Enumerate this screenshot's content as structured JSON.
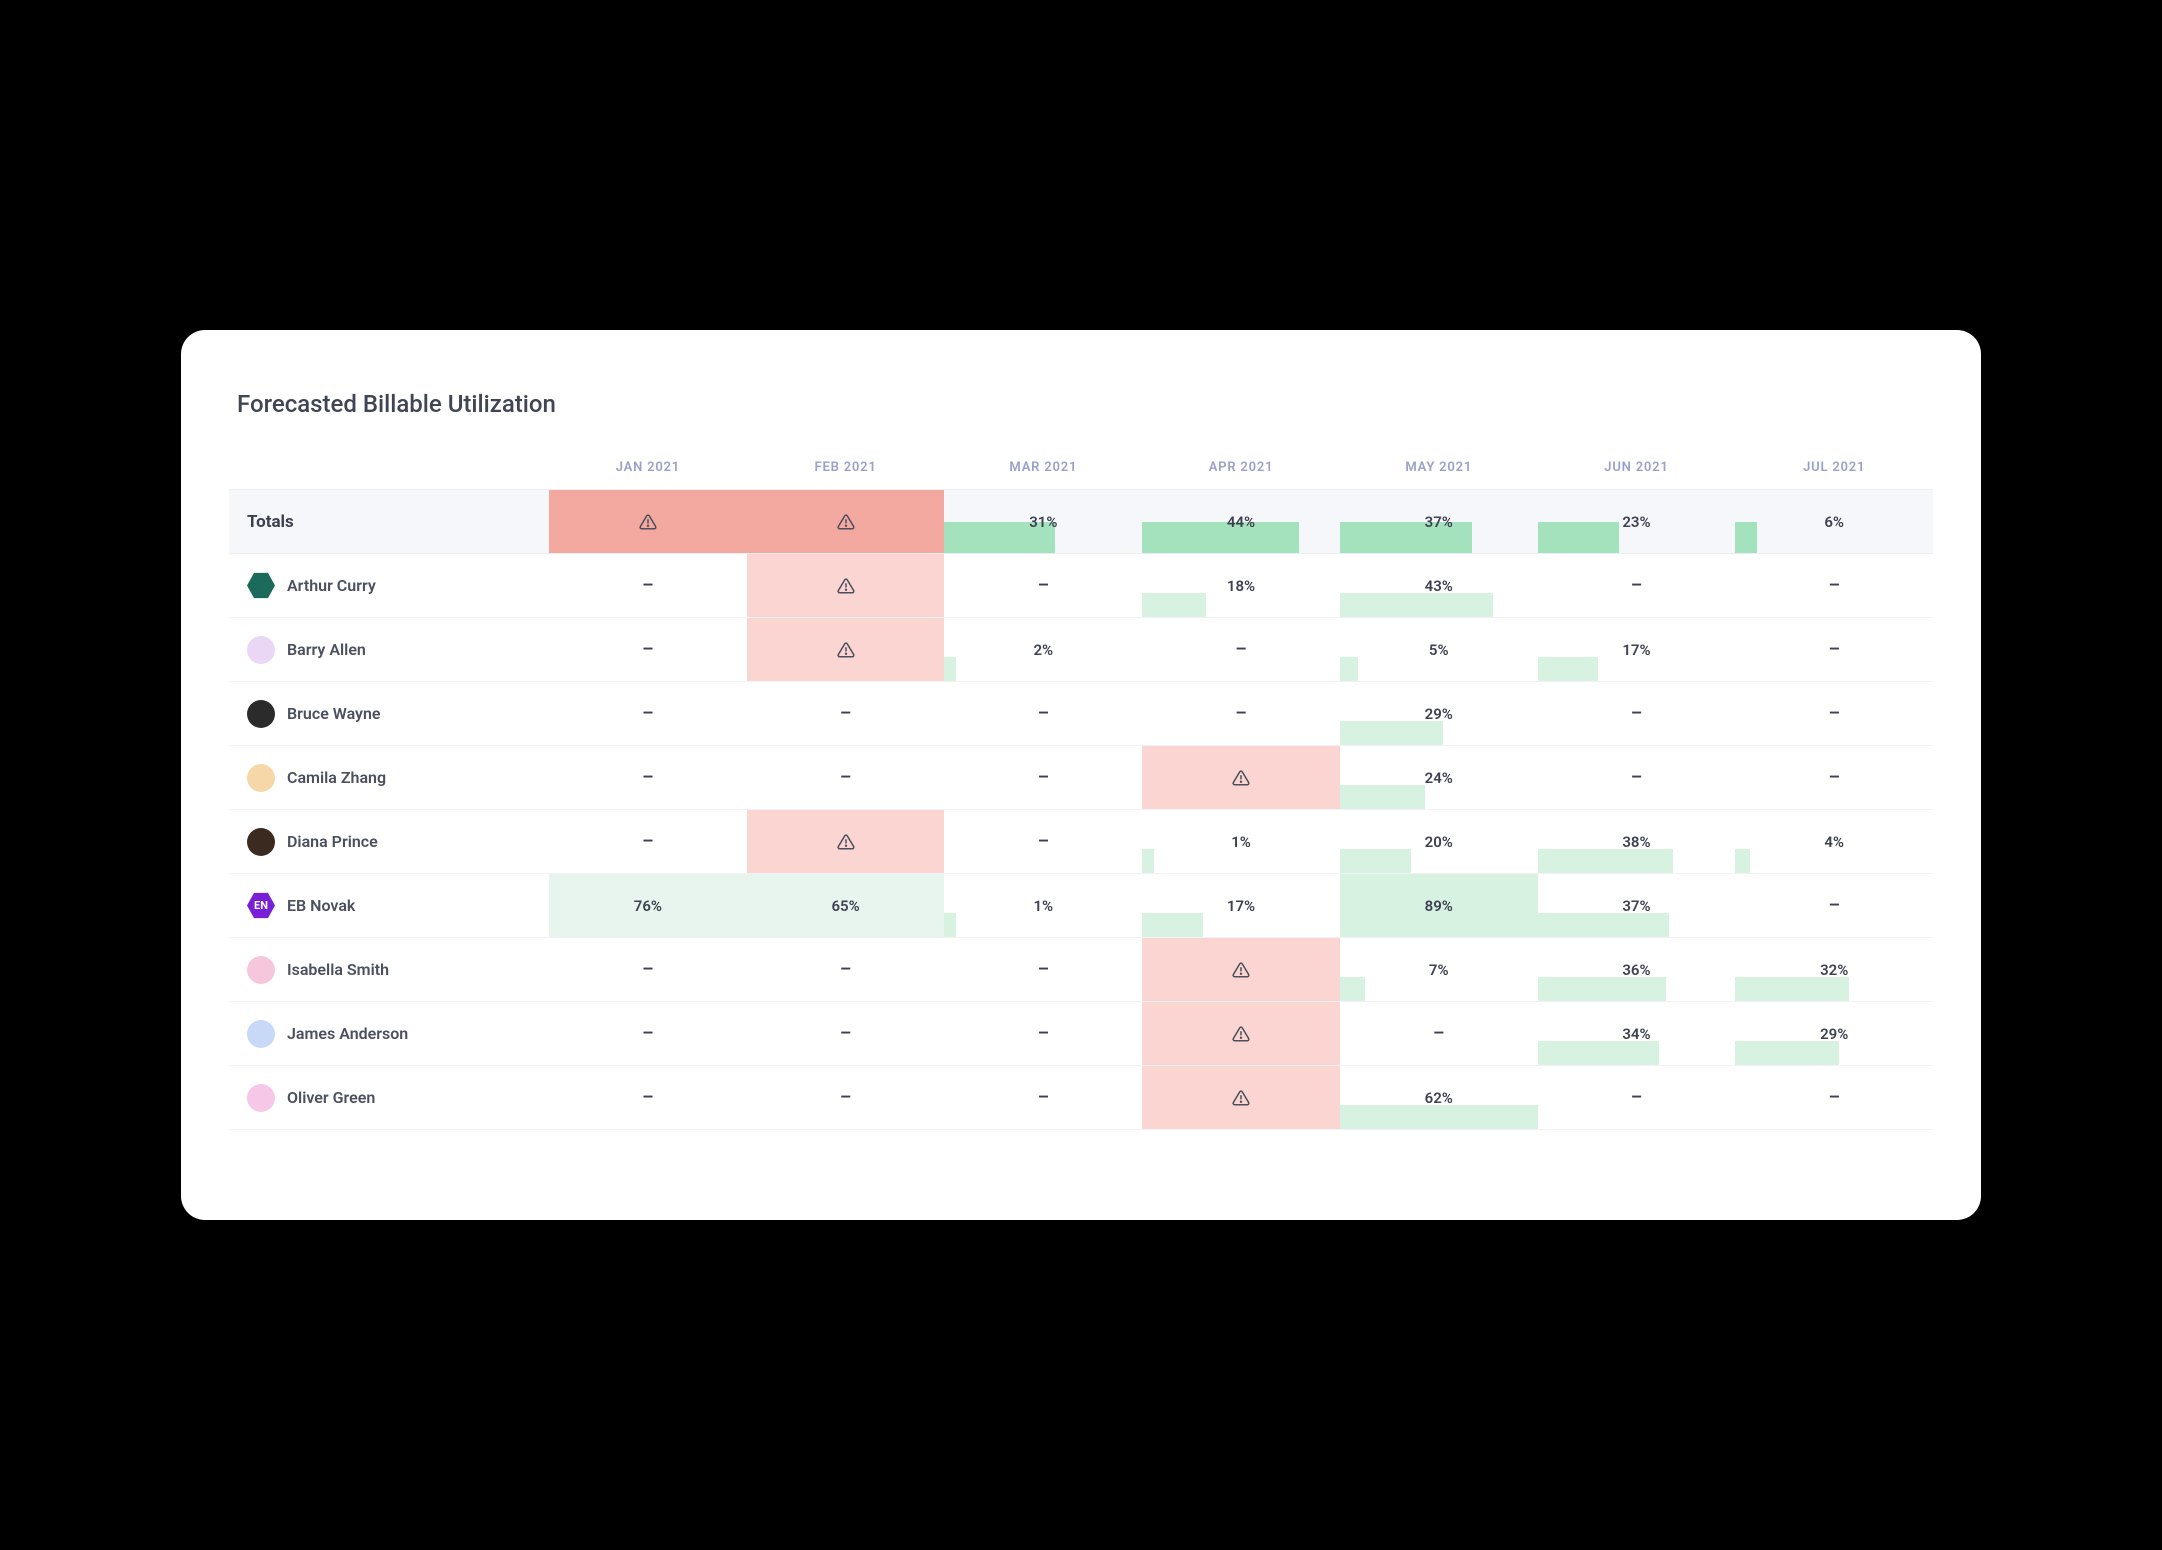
{
  "title": "Forecasted Billable Utilization",
  "months": [
    "JAN 2021",
    "FEB 2021",
    "MAR 2021",
    "APR 2021",
    "MAY 2021",
    "JUN 2021",
    "JUL 2021"
  ],
  "totals_label": "Totals",
  "totals": [
    {
      "type": "warn",
      "bg": "#f3a8a0"
    },
    {
      "type": "warn",
      "bg": "#f3a8a0"
    },
    {
      "type": "pct",
      "value": 31,
      "fill": "#a4e2bd"
    },
    {
      "type": "pct",
      "value": 44,
      "fill": "#a4e2bd"
    },
    {
      "type": "pct",
      "value": 37,
      "fill": "#a4e2bd"
    },
    {
      "type": "pct",
      "value": 23,
      "fill": "#a4e2bd"
    },
    {
      "type": "pct",
      "value": 6,
      "fill": "#a4e2bd"
    }
  ],
  "rows": [
    {
      "name": "Arthur Curry",
      "avatar": {
        "shape": "hex",
        "bg": "#1c6b5a",
        "text": ""
      },
      "cells": [
        {
          "type": "dash"
        },
        {
          "type": "warn",
          "bg": "#fbd5d2"
        },
        {
          "type": "dash"
        },
        {
          "type": "pct",
          "value": 18,
          "fill": "#d8f2e2"
        },
        {
          "type": "pct",
          "value": 43,
          "fill": "#d8f2e2"
        },
        {
          "type": "dash"
        },
        {
          "type": "dash"
        }
      ]
    },
    {
      "name": "Barry Allen",
      "avatar": {
        "shape": "circle",
        "bg": "#e9d7f5",
        "text": ""
      },
      "cells": [
        {
          "type": "dash"
        },
        {
          "type": "warn",
          "bg": "#fbd5d2"
        },
        {
          "type": "pct",
          "value": 2,
          "fill": "#d8f2e2"
        },
        {
          "type": "dash"
        },
        {
          "type": "pct",
          "value": 5,
          "fill": "#d8f2e2"
        },
        {
          "type": "pct",
          "value": 17,
          "fill": "#d8f2e2"
        },
        {
          "type": "dash"
        }
      ]
    },
    {
      "name": "Bruce Wayne",
      "avatar": {
        "shape": "circle",
        "bg": "#2b2b2b",
        "text": ""
      },
      "cells": [
        {
          "type": "dash"
        },
        {
          "type": "dash"
        },
        {
          "type": "dash"
        },
        {
          "type": "dash"
        },
        {
          "type": "pct",
          "value": 29,
          "fill": "#d8f2e2"
        },
        {
          "type": "dash"
        },
        {
          "type": "dash"
        }
      ]
    },
    {
      "name": "Camila Zhang",
      "avatar": {
        "shape": "circle",
        "bg": "#f5d7a8",
        "text": ""
      },
      "cells": [
        {
          "type": "dash"
        },
        {
          "type": "dash"
        },
        {
          "type": "dash"
        },
        {
          "type": "warn",
          "bg": "#fbd5d2"
        },
        {
          "type": "pct",
          "value": 24,
          "fill": "#d8f2e2"
        },
        {
          "type": "dash"
        },
        {
          "type": "dash"
        }
      ]
    },
    {
      "name": "Diana Prince",
      "avatar": {
        "shape": "circle",
        "bg": "#3a2a1f",
        "text": ""
      },
      "cells": [
        {
          "type": "dash"
        },
        {
          "type": "warn",
          "bg": "#fbd5d2"
        },
        {
          "type": "dash"
        },
        {
          "type": "pct",
          "value": 1,
          "fill": "#d8f2e2"
        },
        {
          "type": "pct",
          "value": 20,
          "fill": "#d8f2e2"
        },
        {
          "type": "pct",
          "value": 38,
          "fill": "#d8f2e2"
        },
        {
          "type": "pct",
          "value": 4,
          "fill": "#d8f2e2"
        }
      ]
    },
    {
      "name": "EB Novak",
      "avatar": {
        "shape": "hex",
        "bg": "#7a1fd8",
        "text": "EN"
      },
      "cells": [
        {
          "type": "pct",
          "value": 76,
          "fill": "#e7f5ee",
          "full": true
        },
        {
          "type": "pct",
          "value": 65,
          "fill": "#e7f5ee",
          "full": true
        },
        {
          "type": "pct",
          "value": 1,
          "fill": "#d8f2e2"
        },
        {
          "type": "pct",
          "value": 17,
          "fill": "#d8f2e2"
        },
        {
          "type": "pct",
          "value": 89,
          "fill": "#d8f2e2",
          "full": true
        },
        {
          "type": "pct",
          "value": 37,
          "fill": "#d8f2e2"
        },
        {
          "type": "dash"
        }
      ]
    },
    {
      "name": "Isabella Smith",
      "avatar": {
        "shape": "circle",
        "bg": "#f6c7dc",
        "text": ""
      },
      "cells": [
        {
          "type": "dash"
        },
        {
          "type": "dash"
        },
        {
          "type": "dash"
        },
        {
          "type": "warn",
          "bg": "#fbd5d2"
        },
        {
          "type": "pct",
          "value": 7,
          "fill": "#d8f2e2"
        },
        {
          "type": "pct",
          "value": 36,
          "fill": "#d8f2e2"
        },
        {
          "type": "pct",
          "value": 32,
          "fill": "#d8f2e2"
        }
      ]
    },
    {
      "name": "James Anderson",
      "avatar": {
        "shape": "circle",
        "bg": "#c7d9f6",
        "text": ""
      },
      "cells": [
        {
          "type": "dash"
        },
        {
          "type": "dash"
        },
        {
          "type": "dash"
        },
        {
          "type": "warn",
          "bg": "#fbd5d2"
        },
        {
          "type": "dash"
        },
        {
          "type": "pct",
          "value": 34,
          "fill": "#d8f2e2"
        },
        {
          "type": "pct",
          "value": 29,
          "fill": "#d8f2e2"
        }
      ]
    },
    {
      "name": "Oliver Green",
      "avatar": {
        "shape": "circle",
        "bg": "#f6c7e7",
        "text": ""
      },
      "cells": [
        {
          "type": "dash"
        },
        {
          "type": "dash"
        },
        {
          "type": "dash"
        },
        {
          "type": "warn",
          "bg": "#fbd5d2"
        },
        {
          "type": "pct",
          "value": 62,
          "fill": "#d8f2e2"
        },
        {
          "type": "dash"
        },
        {
          "type": "dash"
        }
      ]
    }
  ]
}
